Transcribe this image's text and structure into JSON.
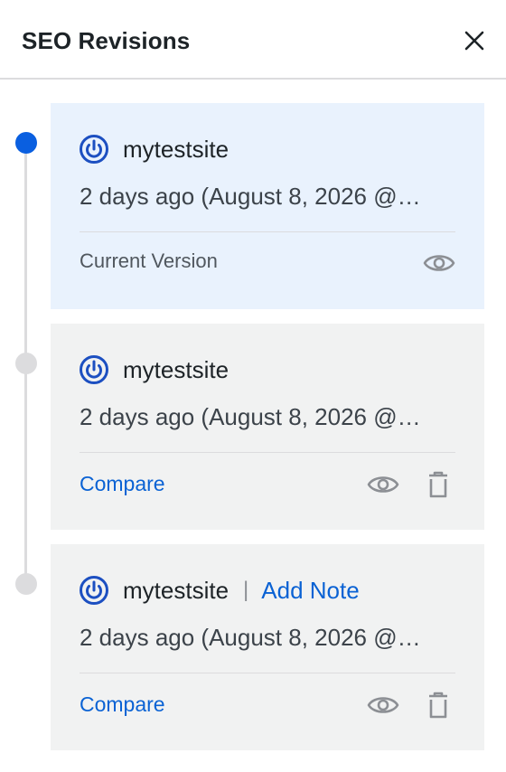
{
  "panel": {
    "title": "SEO Revisions",
    "close_icon": "close-icon"
  },
  "colors": {
    "accent": "#0a5fe0",
    "link": "#0a62d4",
    "current_bg": "#e9f2fd",
    "card_bg": "#f1f2f2",
    "timeline": "#dcdcde"
  },
  "revisions": [
    {
      "user": "mytestsite",
      "date": "2 days ago (August 8, 2026 @…",
      "status_label": "Current Version",
      "view_icon": "eye-icon"
    },
    {
      "user": "mytestsite",
      "date": "2 days ago (August 8, 2026 @…",
      "compare_label": "Compare",
      "view_icon": "eye-icon",
      "delete_icon": "trash-icon"
    },
    {
      "user": "mytestsite",
      "separator": "|",
      "note_label": "Add Note",
      "date": "2 days ago (August 8, 2026 @…",
      "compare_label": "Compare",
      "view_icon": "eye-icon",
      "delete_icon": "trash-icon"
    }
  ]
}
